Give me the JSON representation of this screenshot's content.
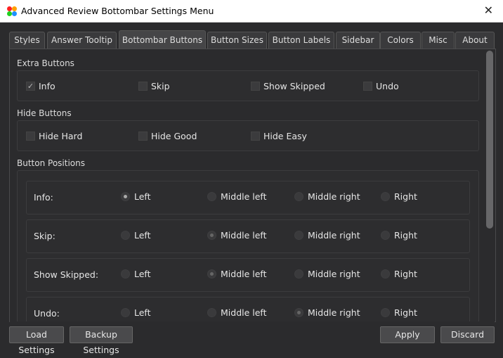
{
  "window": {
    "title": "Advanced Review Bottombar Settings Menu",
    "close_icon": "close-icon",
    "logo_colors": [
      "#ff2020",
      "#ffa000",
      "#20d020",
      "#1e90ff"
    ]
  },
  "tabs": [
    {
      "label": "Styles"
    },
    {
      "label": "Answer Tooltip"
    },
    {
      "label": "Bottombar Buttons",
      "selected": true
    },
    {
      "label": "Button Sizes"
    },
    {
      "label": "Button Labels"
    },
    {
      "label": "Sidebar"
    },
    {
      "label": "Colors"
    },
    {
      "label": "Misc"
    },
    {
      "label": "About"
    }
  ],
  "extra_buttons": {
    "title": "Extra Buttons",
    "items": [
      {
        "label": "Info",
        "checked": true
      },
      {
        "label": "Skip",
        "checked": false
      },
      {
        "label": "Show Skipped",
        "checked": false
      },
      {
        "label": "Undo",
        "checked": false
      }
    ]
  },
  "hide_buttons": {
    "title": "Hide Buttons",
    "items": [
      {
        "label": "Hide Hard",
        "checked": false
      },
      {
        "label": "Hide Good",
        "checked": false
      },
      {
        "label": "Hide Easy",
        "checked": false
      }
    ]
  },
  "positions": {
    "title": "Button Positions",
    "options": [
      "Left",
      "Middle left",
      "Middle right",
      "Right"
    ],
    "rows": [
      {
        "label": "Info:",
        "selected": "Left"
      },
      {
        "label": "Skip:",
        "selected": "Middle left"
      },
      {
        "label": "Show Skipped:",
        "selected": "Middle left"
      },
      {
        "label": "Undo:",
        "selected": "Middle right"
      }
    ]
  },
  "footer": {
    "load": "Load Settings",
    "backup": "Backup Settings",
    "apply": "Apply",
    "discard": "Discard"
  }
}
